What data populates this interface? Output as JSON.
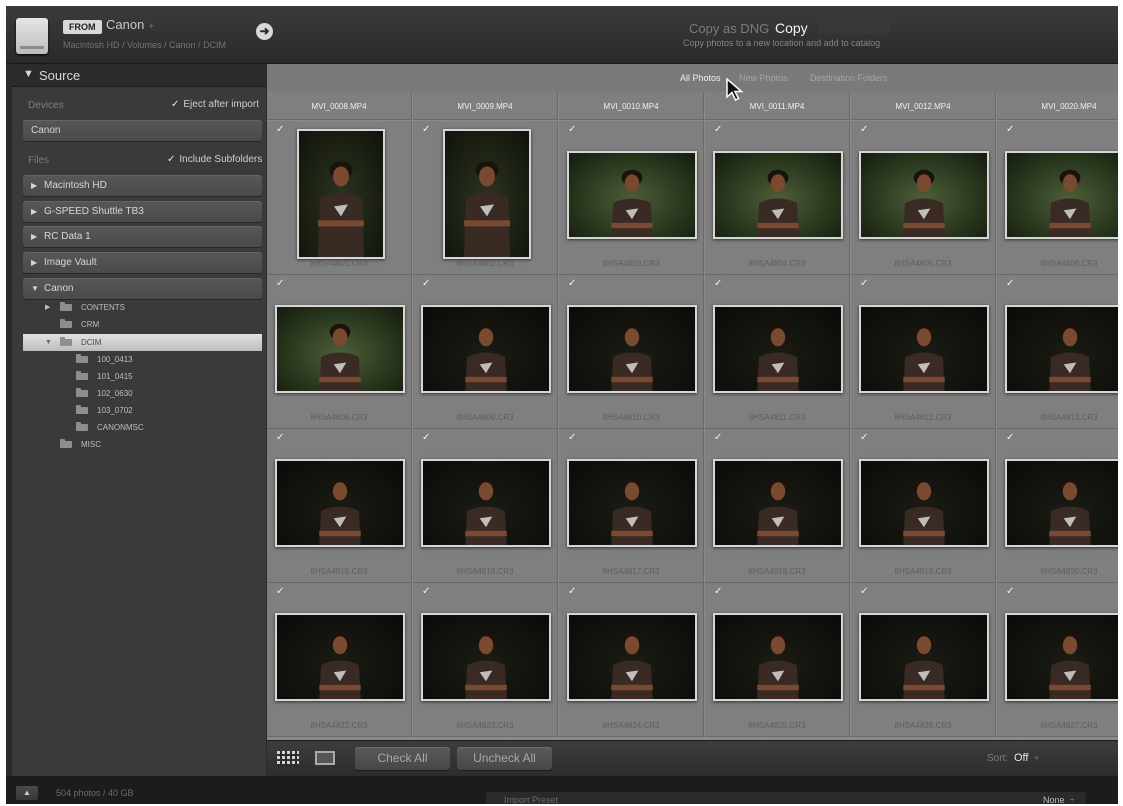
{
  "topbar": {
    "from_label": "FROM",
    "source_name": "Canon",
    "source_caret": "÷",
    "source_path": "Macintosh HD / Volumes / Canon / DCIM",
    "go_icon": "arrow-right-circle-icon",
    "import_mode_prev": "Copy as DNG",
    "import_mode_current": "Copy",
    "import_mode_desc": "Copy photos to a new location and add to catalog"
  },
  "source_panel": {
    "title": "Source",
    "devices_label": "Devices",
    "eject_label": "Eject after import",
    "device_name": "Canon",
    "files_label": "Files",
    "subfolders_label": "Include Subfolders",
    "volumes": [
      "Macintosh HD",
      "G-SPEED Shuttle TB3",
      "RC Data 1",
      "Image Vault",
      "Canon"
    ],
    "folders": [
      "CONTENTS",
      "CRM",
      "DCIM",
      "100_0413",
      "101_0415",
      "102_0630",
      "103_0702",
      "CANONMSC",
      "MISC"
    ],
    "selected_folder": "DCIM"
  },
  "filter_tabs": [
    "All Photos",
    "New Photos",
    "Destination Folders"
  ],
  "active_filter": "All Photos",
  "grid": {
    "header_row": [
      "MVI_0008.MP4",
      "MVI_0009.MP4",
      "MVI_0010.MP4",
      "MVI_0011.MP4",
      "MVI_0012.MP4",
      "MVI_0020.MP4"
    ],
    "photos": [
      "8HSA4801.CR3",
      "8HSA4802.CR3",
      "8HSA4803.CR3",
      "8HSA4804.CR3",
      "8HSA4805.CR3",
      "8HSA4806.CR3",
      "8HSA4808.CR3",
      "8HSA4809.CR3",
      "8HSA4810.CR3",
      "8HSA4811.CR3",
      "8HSA4812.CR3",
      "8HSA4813.CR3",
      "8HSA4815.CR3",
      "8HSA4816.CR3",
      "8HSA4817.CR3",
      "8HSA4818.CR3",
      "8HSA4819.CR3",
      "8HSA4820.CR3",
      "8HSA4822.CR3",
      "8HSA4823.CR3",
      "8HSA4824.CR3",
      "8HSA4825.CR3",
      "8HSA4826.CR3",
      "8HSA4827.CR3"
    ],
    "check_mark": "✓"
  },
  "toolbar": {
    "grid_view_icon": "grid-view-icon",
    "loupe_view_icon": "loupe-view-icon",
    "check_all": "Check All",
    "uncheck_all": "Uncheck All",
    "sort_label": "Sort:",
    "sort_value": "Off",
    "sort_caret": "÷"
  },
  "status": {
    "photo_count": "504 photos / 40 GB",
    "preset_label": "Import Preset",
    "preset_value": "None",
    "preset_caret": "÷"
  }
}
